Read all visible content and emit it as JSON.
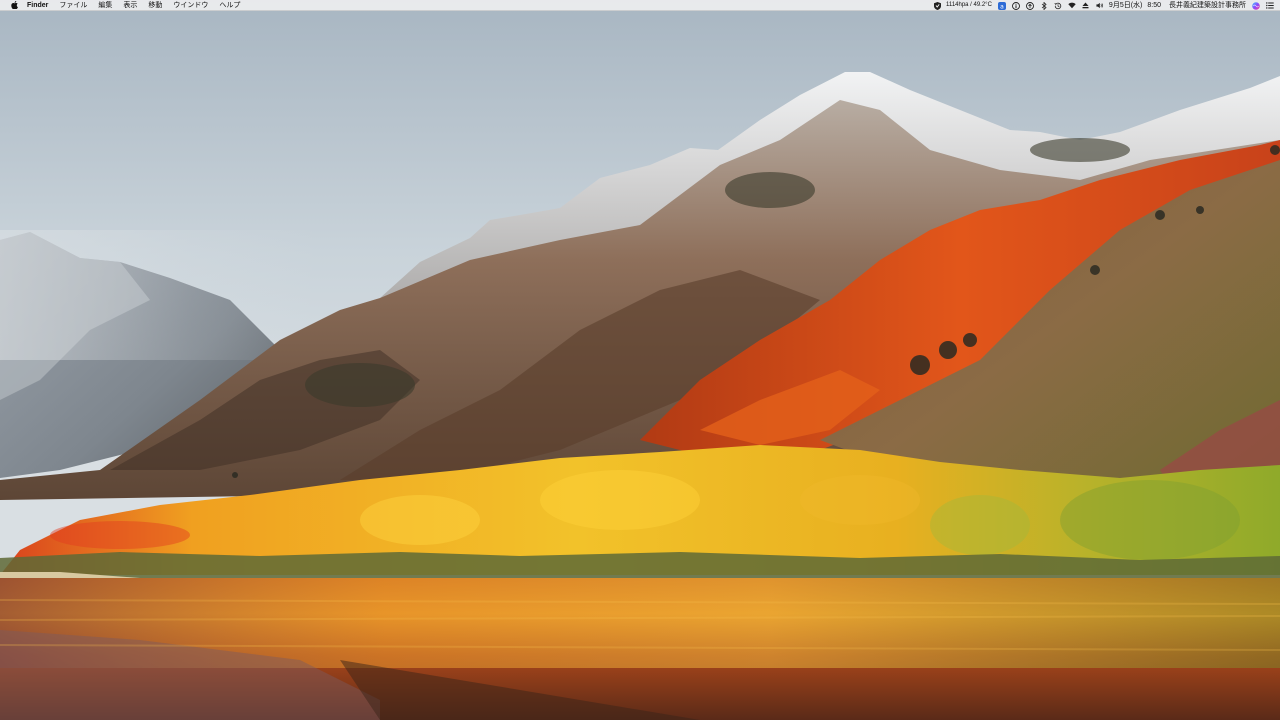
{
  "menubar": {
    "apple_icon": "apple-icon",
    "app_name": "Finder",
    "menus": [
      "ファイル",
      "編集",
      "表示",
      "移動",
      "ウインドウ",
      "ヘルプ"
    ],
    "status": {
      "weather": "1114hpa / 49.2°C",
      "date": "9月5日(水)",
      "time": "8:50",
      "user": "長井義紀建築設計事務所",
      "icons": [
        "shield-icon",
        "app-icon",
        "info-icon",
        "sync-icon",
        "bluetooth-icon",
        "time-machine-icon",
        "wifi-icon",
        "eject-icon",
        "volume-icon",
        "siri-icon"
      ]
    }
  },
  "wallpaper": {
    "name": "macOS High Sierra",
    "sky_color": "#c9d3da",
    "water_color": "#8a3a18"
  }
}
